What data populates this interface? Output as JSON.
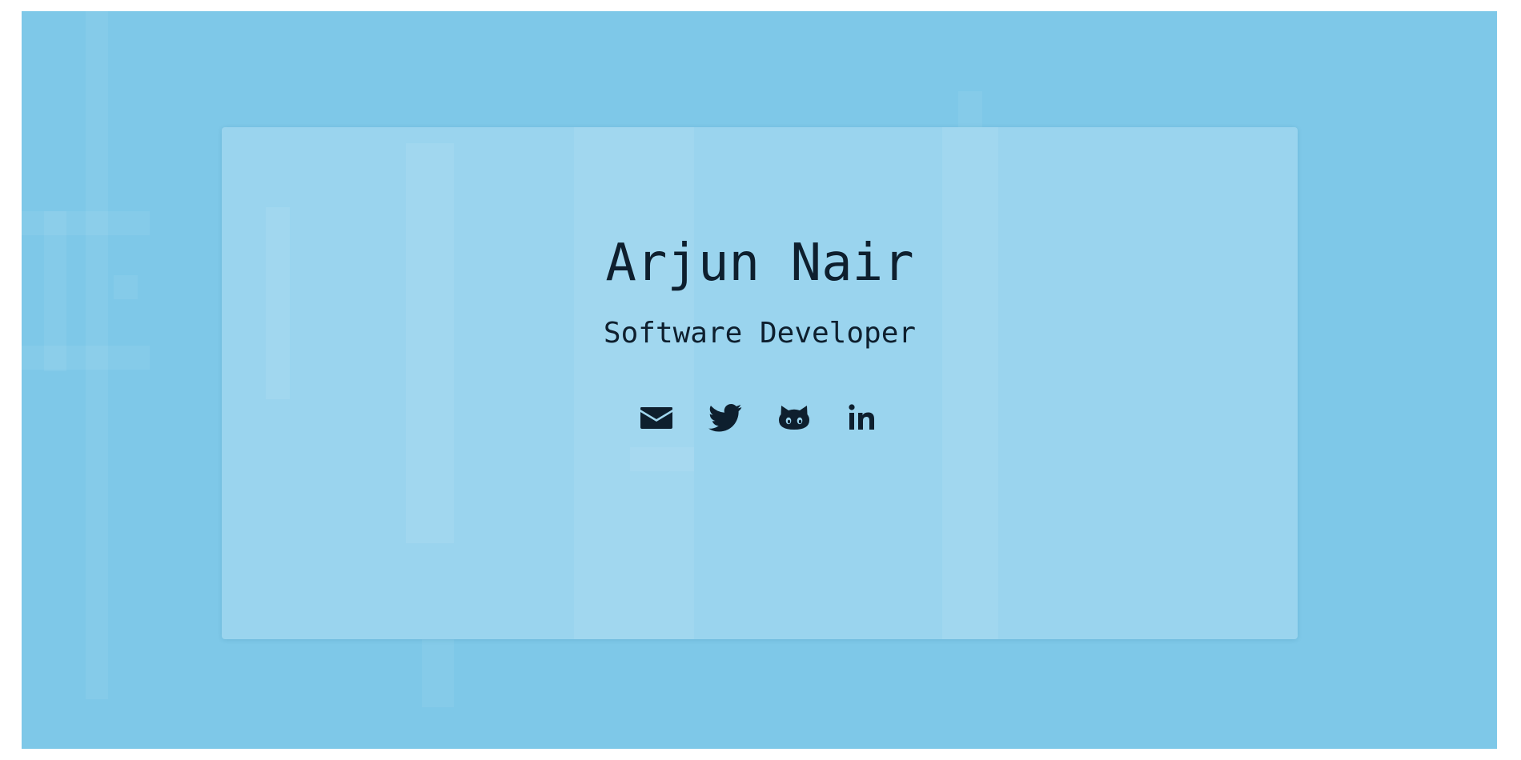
{
  "profile": {
    "name": "Arjun Nair",
    "title": "Software Developer"
  },
  "social_links": [
    {
      "icon": "envelope-icon",
      "label": "Email"
    },
    {
      "icon": "twitter-icon",
      "label": "Twitter"
    },
    {
      "icon": "github-icon",
      "label": "GitHub"
    },
    {
      "icon": "linkedin-icon",
      "label": "LinkedIn"
    }
  ],
  "colors": {
    "background": "#7ec8e8",
    "card": "#9ad4ee",
    "text": "#0e1f2e"
  }
}
